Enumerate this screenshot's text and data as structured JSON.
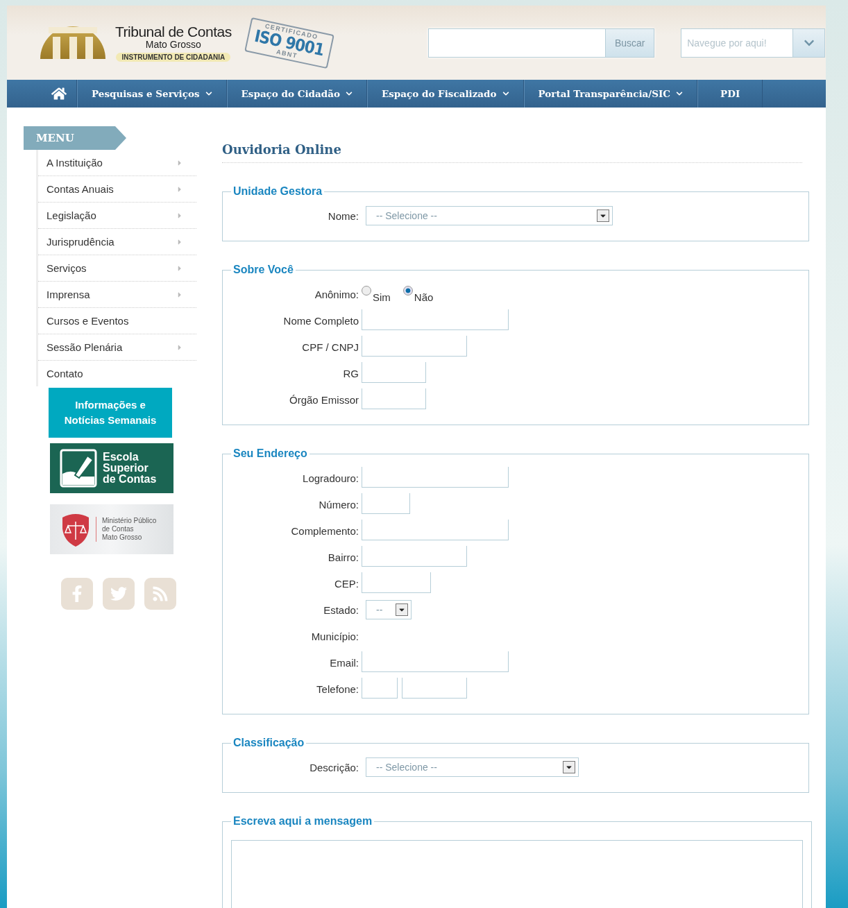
{
  "header": {
    "logo": {
      "title": "Tribunal de Contas",
      "subtitle": "Mato Grosso",
      "tagline": "INSTRUMENTO DE CIDADANIA"
    },
    "iso_badge": {
      "top": "CERTIFICADO",
      "main": "ISO 9001",
      "bottom": "ABNT"
    },
    "search": {
      "button": "Buscar"
    },
    "navigator": {
      "placeholder": "Navegue por aqui!"
    }
  },
  "nav": {
    "items": [
      {
        "label": "Pesquisas e Serviços",
        "dropdown": true
      },
      {
        "label": "Espaço do Cidadão",
        "dropdown": true
      },
      {
        "label": "Espaço do Fiscalizado",
        "dropdown": true
      },
      {
        "label": "Portal Transparência/SIC",
        "dropdown": true
      },
      {
        "label": "PDI",
        "dropdown": false
      }
    ]
  },
  "sidebar": {
    "menu_title": "MENU",
    "items": [
      {
        "label": "A Instituição",
        "submenu": true
      },
      {
        "label": "Contas Anuais",
        "submenu": true
      },
      {
        "label": "Legislação",
        "submenu": true
      },
      {
        "label": "Jurisprudência",
        "submenu": true
      },
      {
        "label": "Serviços",
        "submenu": true
      },
      {
        "label": "Imprensa",
        "submenu": true
      },
      {
        "label": "Cursos e Eventos",
        "submenu": false
      },
      {
        "label": "Sessão Plenária",
        "submenu": true
      },
      {
        "label": "Contato",
        "submenu": false
      }
    ],
    "banners": [
      {
        "kind": "info",
        "text": "Informações e Notícias Semanais"
      },
      {
        "kind": "school",
        "lines": [
          "Escola",
          "Superior",
          "de Contas"
        ]
      },
      {
        "kind": "ministry",
        "lines": [
          "Ministério Público",
          "de Contas",
          "Mato Grosso"
        ]
      }
    ]
  },
  "form": {
    "title": "Ouvidoria Online",
    "fieldsets": [
      {
        "legend": "Unidade Gestora",
        "fields": [
          {
            "label": "Nome:",
            "kind": "select",
            "value": "-- Selecione --"
          }
        ]
      },
      {
        "legend": "Sobre Você",
        "fields": [
          {
            "label": "Anônimo:",
            "kind": "radio",
            "options": [
              {
                "label": "Sim",
                "selected": false
              },
              {
                "label": "Não",
                "selected": true
              }
            ]
          },
          {
            "label": "Nome Completo",
            "kind": "text"
          },
          {
            "label": "CPF / CNPJ",
            "kind": "text"
          },
          {
            "label": "RG",
            "kind": "text"
          },
          {
            "label": "Órgão Emissor",
            "kind": "text"
          }
        ]
      },
      {
        "legend": "Seu Endereço",
        "fields": [
          {
            "label": "Logradouro:",
            "kind": "text"
          },
          {
            "label": "Número:",
            "kind": "text"
          },
          {
            "label": "Complemento:",
            "kind": "text"
          },
          {
            "label": "Bairro:",
            "kind": "text"
          },
          {
            "label": "CEP:",
            "kind": "text"
          },
          {
            "label": "Estado:",
            "kind": "select",
            "value": "--"
          },
          {
            "label": "Município:",
            "kind": "empty"
          },
          {
            "label": "Email:",
            "kind": "text"
          },
          {
            "label": "Telefone:",
            "kind": "phone"
          }
        ]
      },
      {
        "legend": "Classificação",
        "fields": [
          {
            "label": "Descrição:",
            "kind": "select",
            "value": "-- Selecione --"
          }
        ]
      },
      {
        "legend": "Escreva aqui a mensagem",
        "fields": [
          {
            "kind": "textarea"
          }
        ]
      }
    ]
  }
}
